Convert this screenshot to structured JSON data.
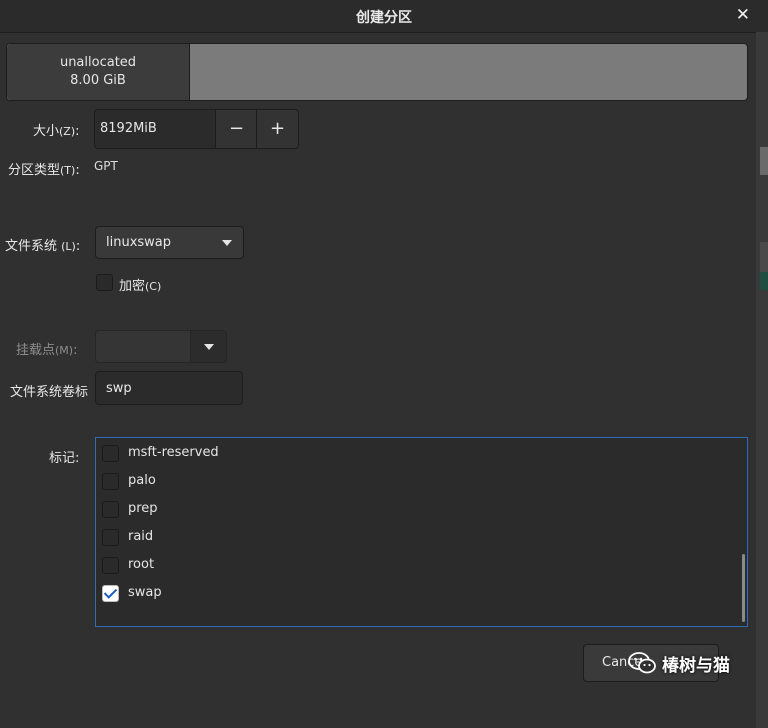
{
  "window": {
    "title": "创建分区"
  },
  "partition_bar": {
    "label": "unallocated",
    "size": "8.00 GiB"
  },
  "size": {
    "label": "大小",
    "mnemonic": "(Z)",
    "colon": ":",
    "value": "8192MiB",
    "minus": "−",
    "plus": "+"
  },
  "partition_type": {
    "label": "分区类型",
    "mnemonic": "(T)",
    "colon": ":",
    "value": "GPT"
  },
  "filesystem": {
    "label": "文件系统 ",
    "mnemonic": "(L)",
    "colon": ":",
    "value": "linuxswap"
  },
  "encrypt": {
    "label": "加密",
    "mnemonic": "(C)",
    "checked": false
  },
  "mount_point": {
    "label": "挂载点",
    "mnemonic": "(M)",
    "colon": ":",
    "value": ""
  },
  "fs_label": {
    "label": "文件系统卷标",
    "value": "swp"
  },
  "flags": {
    "label": "标记:",
    "items": [
      {
        "name": "msft-reserved",
        "checked": false
      },
      {
        "name": "palo",
        "checked": false
      },
      {
        "name": "prep",
        "checked": false
      },
      {
        "name": "raid",
        "checked": false
      },
      {
        "name": "root",
        "checked": false
      },
      {
        "name": "swap",
        "checked": true
      }
    ]
  },
  "buttons": {
    "cancel": "Cance"
  },
  "watermark": {
    "text": "椿树与猫"
  },
  "colors": {
    "accent": "#2f6db3",
    "check": "#1d5fbf",
    "bg": "#303030"
  },
  "icons": {
    "close": "close-icon",
    "dropdown": "chevron-down-icon",
    "watermark": "wechat-icon"
  }
}
